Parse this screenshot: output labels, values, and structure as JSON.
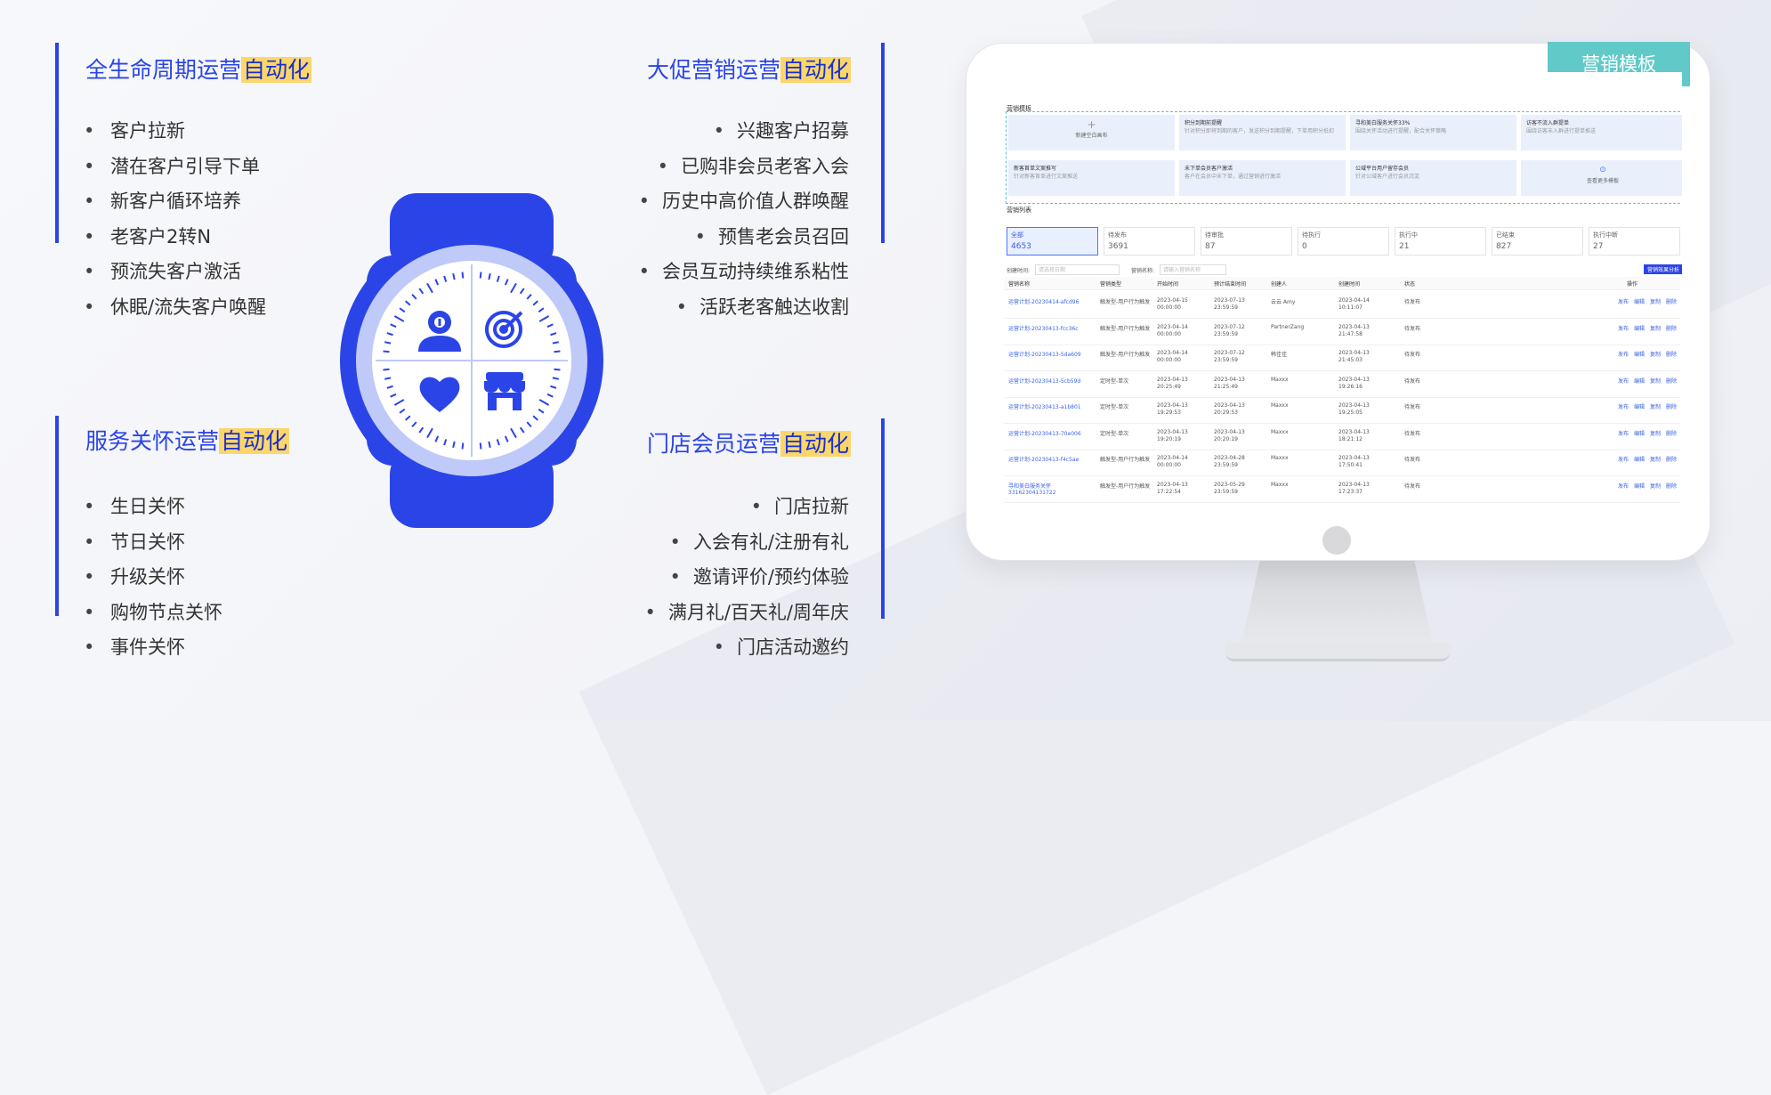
{
  "sections": {
    "top_left": {
      "title_plain": "全生命周期运营",
      "title_highlight": "自动化",
      "items": [
        "客户拉新",
        "潜在客户引导下单",
        "新客户循环培养",
        "老客户2转N",
        "预流失客户激活",
        "休眠/流失客户唤醒"
      ]
    },
    "top_right": {
      "title_plain": "大促营销运营",
      "title_highlight": "自动化",
      "items": [
        "兴趣客户招募",
        "已购非会员老客入会",
        "历史中高价值人群唤醒",
        "预售老会员召回",
        "会员互动持续维系粘性",
        "活跃老客触达收割"
      ]
    },
    "bottom_left": {
      "title_plain": "服务关怀运营",
      "title_highlight": "自动化",
      "items": [
        "生日关怀",
        "节日关怀",
        "升级关怀",
        "购物节点关怀",
        "事件关怀"
      ]
    },
    "bottom_right": {
      "title_plain": "门店会员运营",
      "title_highlight": "自动化",
      "items": [
        "门店拉新",
        "入会有礼/注册有礼",
        "邀请评价/预约体验",
        "满月礼/百天礼/周年庆",
        "门店活动邀约"
      ]
    }
  },
  "bullet": "•",
  "monitor": {
    "tag_label": "营销模板",
    "section_label": "营销模板",
    "list_label": "营销列表",
    "template_cards": [
      {
        "title": "新建空白画布",
        "desc": ""
      },
      {
        "title": "积分到期前提醒",
        "desc": "针对积分即将到期的客户，发送积分到期提醒，下单用积分抵扣"
      },
      {
        "title": "寻和美白服务关怀33%",
        "desc": "围绕关怀活动进行提醒，配合关怀策略"
      },
      {
        "title": "访客不流入群提单",
        "desc": "围绕访客未入群进行提单推送"
      },
      {
        "title": "新客首单文案推写",
        "desc": "针对新客首单进行文案推送"
      },
      {
        "title": "未下单会员客户激活",
        "desc": "客户在会员中未下单，通过营销进行激活"
      },
      {
        "title": "公域平台用户留存会员",
        "desc": "针对公域客户进行会员沉淀"
      },
      {
        "title": "查看更多模板",
        "desc": ""
      }
    ],
    "stats": [
      {
        "label": "全部",
        "value": "4653"
      },
      {
        "label": "待发布",
        "value": "3691"
      },
      {
        "label": "待审批",
        "value": "87"
      },
      {
        "label": "待执行",
        "value": "0"
      },
      {
        "label": "执行中",
        "value": "21"
      },
      {
        "label": "已结束",
        "value": "827"
      },
      {
        "label": "执行中断",
        "value": "27"
      }
    ],
    "filter": {
      "time_label": "创建时间:",
      "time_placeholder": "请选择日期",
      "name_label": "营销名称:",
      "name_placeholder": "请输入营销名称",
      "action_button": "营销效果分析"
    },
    "columns": [
      "营销名称",
      "营销类型",
      "开始时间",
      "预计结束时间",
      "创建人",
      "创建时间",
      "状态",
      "操作"
    ],
    "rows": [
      {
        "name": "运营计划-20230414-afcd96",
        "type": "触发型-用户行为触发",
        "start": "2023-04-15 00:00:00",
        "end": "2023-07-13 23:59:59",
        "creator": "云云 Amy",
        "created": "2023-04-14 10:11:07",
        "status": "待发布"
      },
      {
        "name": "运营计划-20230413-fcc36c",
        "type": "触发型-用户行为触发",
        "start": "2023-04-14 00:00:00",
        "end": "2023-07-12 23:59:59",
        "creator": "PartnerZang",
        "created": "2023-04-13 21:47:58",
        "status": "待发布"
      },
      {
        "name": "运营计划-20230413-5da609",
        "type": "触发型-用户行为触发",
        "start": "2023-04-14 00:00:00",
        "end": "2023-07-12 23:59:59",
        "creator": "韩佳佳",
        "created": "2023-04-13 21:45:03",
        "status": "待发布"
      },
      {
        "name": "运营计划-20230413-5cb59d",
        "type": "定时型-单次",
        "start": "2023-04-13 20:25:49",
        "end": "2023-04-13 21:25:49",
        "creator": "Maxxx",
        "created": "2023-04-13 19:26:16",
        "status": "待发布"
      },
      {
        "name": "运营计划-20230413-a1b801",
        "type": "定时型-单次",
        "start": "2023-04-13 19:29:53",
        "end": "2023-04-13 20:29:53",
        "creator": "Maxxx",
        "created": "2023-04-13 19:25:05",
        "status": "待发布"
      },
      {
        "name": "运营计划-20230413-70e006",
        "type": "定时型-单次",
        "start": "2023-04-13 19:20:19",
        "end": "2023-04-13 20:20:19",
        "creator": "Maxxx",
        "created": "2023-04-13 18:21:12",
        "status": "待发布"
      },
      {
        "name": "运营计划-20230413-f4c5ae",
        "type": "触发型-用户行为触发",
        "start": "2023-04-14 00:00:00",
        "end": "2023-04-28 23:59:59",
        "creator": "Maxxx",
        "created": "2023-04-13 17:50:41",
        "status": "待发布"
      },
      {
        "name": "寻和美白服务关怀33162304131722",
        "type": "触发型-用户行为触发",
        "start": "2023-04-13 17:22:54",
        "end": "2023-05-29 23:59:59",
        "creator": "Maxxx",
        "created": "2023-04-13 17:23:37",
        "status": "待发布"
      }
    ],
    "row_actions": [
      "发布",
      "编辑",
      "复制",
      "删除"
    ]
  },
  "colors": {
    "accent": "#2b44e8",
    "highlight": "#fbd66b",
    "teal": "#62c9c9"
  }
}
